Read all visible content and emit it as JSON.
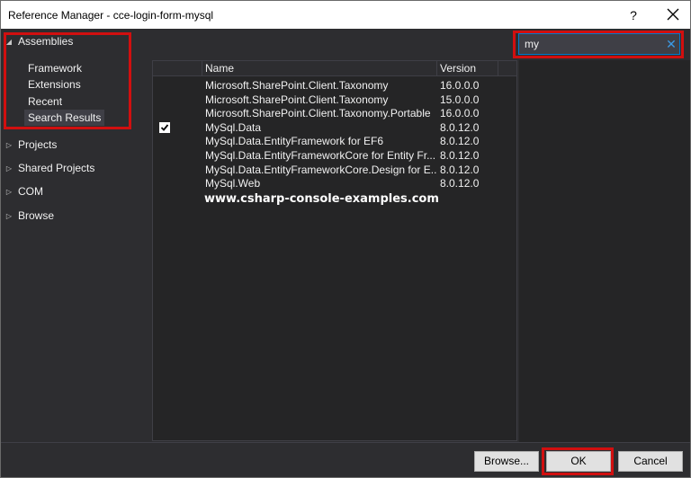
{
  "window": {
    "title": "Reference Manager - cce-login-form-mysql",
    "help_label": "?",
    "close_icon": "close-icon"
  },
  "nav": {
    "assemblies": {
      "label": "Assemblies",
      "expanded": true
    },
    "assemblies_items": [
      "Framework",
      "Extensions",
      "Recent",
      "Search Results"
    ],
    "selected_item": "Search Results",
    "groups": [
      "Projects",
      "Shared Projects",
      "COM",
      "Browse"
    ]
  },
  "search": {
    "value": "my",
    "clear_icon": "clear-icon"
  },
  "grid": {
    "columns": [
      "Name",
      "Version"
    ],
    "rows": [
      {
        "name": "Microsoft.SharePoint.Client.Taxonomy",
        "version": "16.0.0.0",
        "checked": false
      },
      {
        "name": "Microsoft.SharePoint.Client.Taxonomy",
        "version": "15.0.0.0",
        "checked": false
      },
      {
        "name": "Microsoft.SharePoint.Client.Taxonomy.Portable",
        "version": "16.0.0.0",
        "checked": false
      },
      {
        "name": "MySql.Data",
        "version": "8.0.12.0",
        "checked": true
      },
      {
        "name": "MySql.Data.EntityFramework for EF6",
        "version": "8.0.12.0",
        "checked": false
      },
      {
        "name": "MySql.Data.EntityFrameworkCore for Entity Fr...",
        "version": "8.0.12.0",
        "checked": false
      },
      {
        "name": "MySql.Data.EntityFrameworkCore.Design for E...",
        "version": "8.0.12.0",
        "checked": false
      },
      {
        "name": "MySql.Web",
        "version": "8.0.12.0",
        "checked": false
      }
    ]
  },
  "watermark": "www.csharp-console-examples.com",
  "footer": {
    "browse": "Browse...",
    "ok": "OK",
    "cancel": "Cancel"
  },
  "colors": {
    "highlight": "#d10f0f",
    "accent": "#007acc",
    "background": "#2d2d30"
  }
}
